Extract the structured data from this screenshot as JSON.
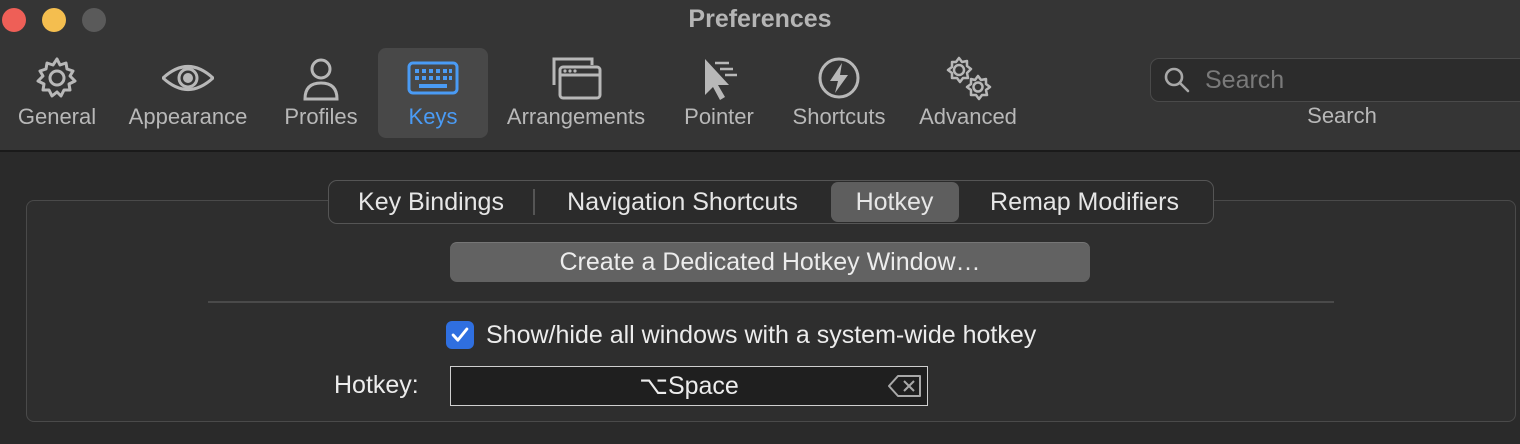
{
  "window": {
    "title": "Preferences"
  },
  "toolbar": {
    "items": [
      {
        "label": "General",
        "icon": "gear-icon"
      },
      {
        "label": "Appearance",
        "icon": "eye-icon"
      },
      {
        "label": "Profiles",
        "icon": "person-icon"
      },
      {
        "label": "Keys",
        "icon": "keyboard-icon",
        "selected": true
      },
      {
        "label": "Arrangements",
        "icon": "windows-icon"
      },
      {
        "label": "Pointer",
        "icon": "pointer-icon"
      },
      {
        "label": "Shortcuts",
        "icon": "lightning-icon"
      },
      {
        "label": "Advanced",
        "icon": "gears-icon"
      }
    ],
    "search": {
      "placeholder": "Search",
      "caption": "Search"
    }
  },
  "tabs": [
    {
      "label": "Key Bindings"
    },
    {
      "label": "Navigation Shortcuts"
    },
    {
      "label": "Hotkey",
      "selected": true
    },
    {
      "label": "Remap Modifiers"
    }
  ],
  "hotkey_pane": {
    "create_button_label": "Create a Dedicated Hotkey Window…",
    "show_hide_label": "Show/hide all windows with a system-wide hotkey",
    "show_hide_checked": true,
    "hotkey_label": "Hotkey:",
    "hotkey_value": "⌥Space"
  },
  "colors": {
    "accent": "#4a9bf5",
    "checkbox": "#2f6fe0",
    "traffic_close": "#ee5f57",
    "traffic_minimize": "#f4be4f"
  }
}
